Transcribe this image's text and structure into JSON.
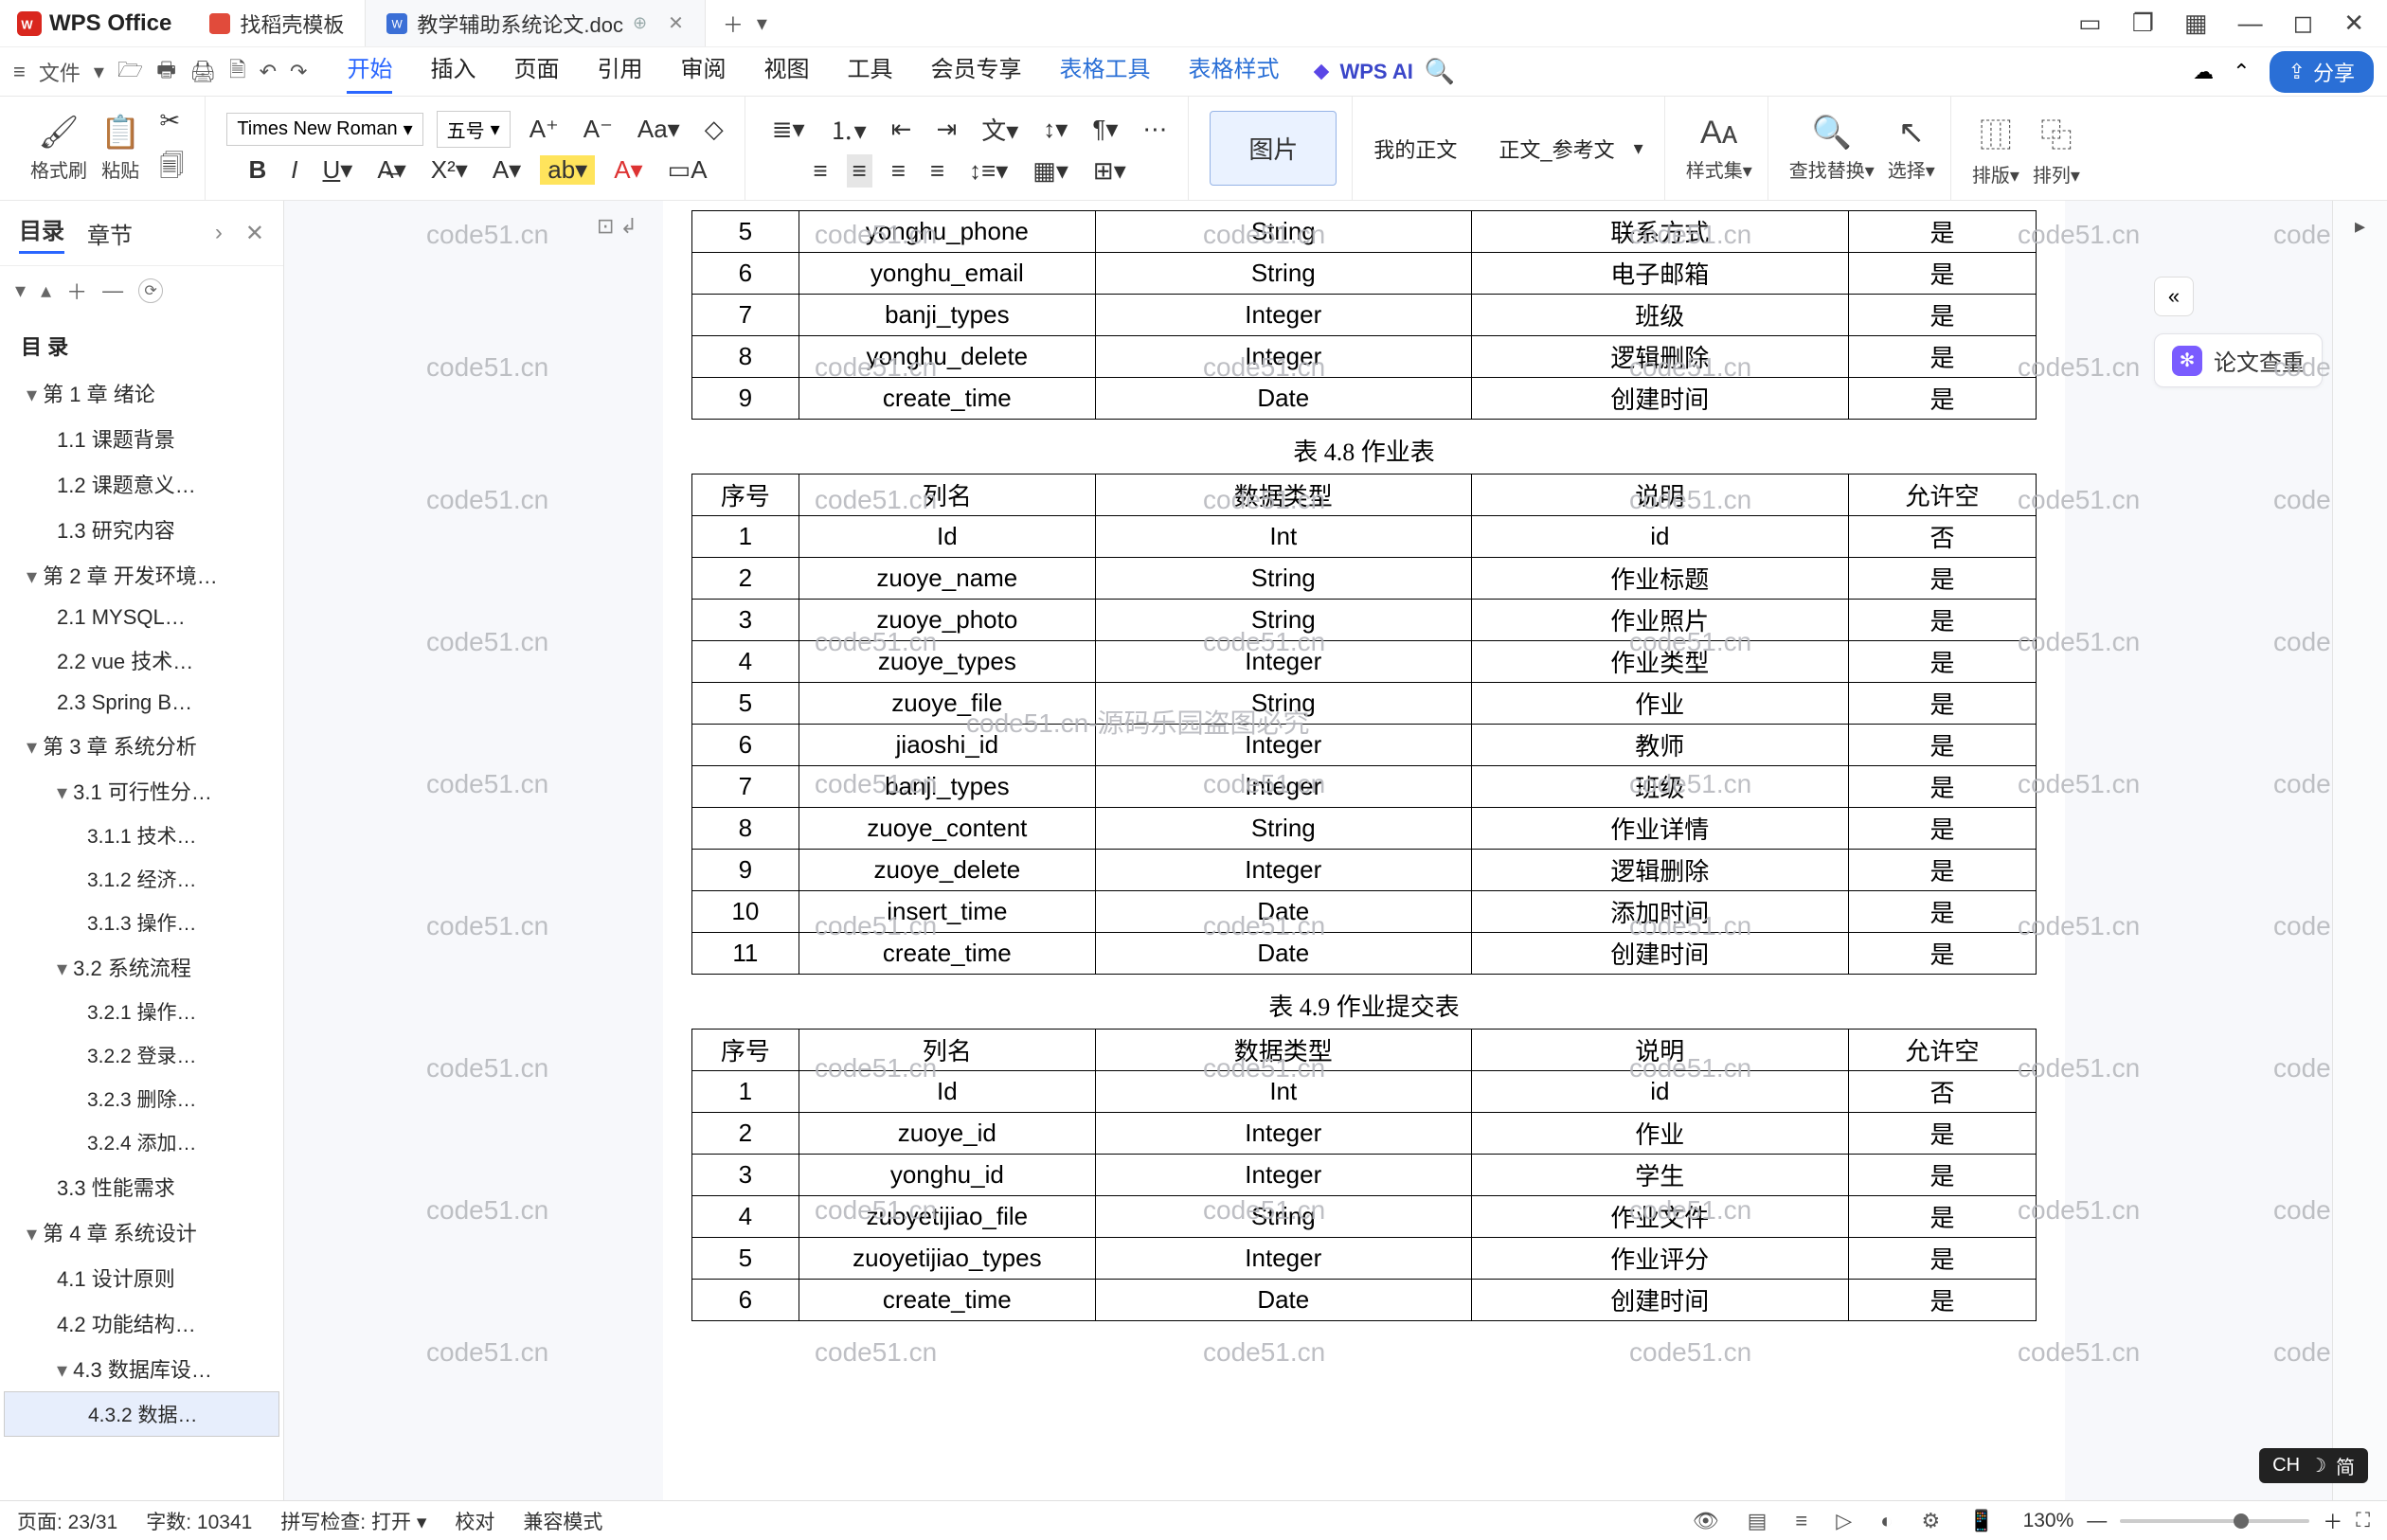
{
  "titlebar": {
    "app": "WPS Office",
    "tabs": [
      {
        "icon": "doc-red",
        "label": "找稻壳模板"
      },
      {
        "icon": "doc-blue",
        "label": "教学辅助系统论文.doc",
        "active": true
      }
    ]
  },
  "menubar": {
    "file": "文件",
    "items": [
      "开始",
      "插入",
      "页面",
      "引用",
      "审阅",
      "视图",
      "工具",
      "会员专享",
      "表格工具",
      "表格样式"
    ],
    "active": 0,
    "blue": [
      8,
      9
    ],
    "wpsai": "WPS AI",
    "share": "分享"
  },
  "ribbon": {
    "format_painter": "格式刷",
    "paste": "粘贴",
    "font_family": "Times New Roman",
    "font_size": "五号",
    "image_btn": "图片",
    "my_body": "我的正文",
    "style_ref": "正文_参考文",
    "styles": "样式集",
    "find": "查找替换",
    "select": "选择",
    "arrange": "排版",
    "align": "排列"
  },
  "sidebar": {
    "tab1": "目录",
    "tab2": "章节",
    "title": "目 录",
    "items": [
      {
        "lvl": 1,
        "txt": "第 1 章 绪论"
      },
      {
        "lvl": 2,
        "txt": "1.1 课题背景"
      },
      {
        "lvl": 2,
        "txt": "1.2 课题意义…"
      },
      {
        "lvl": 2,
        "txt": "1.3 研究内容"
      },
      {
        "lvl": 1,
        "txt": "第 2 章 开发环境…"
      },
      {
        "lvl": 2,
        "txt": "2.1 MYSQL…"
      },
      {
        "lvl": 2,
        "txt": "2.2 vue 技术…"
      },
      {
        "lvl": 2,
        "txt": "2.3 Spring B…"
      },
      {
        "lvl": 1,
        "txt": "第 3 章 系统分析"
      },
      {
        "lvl": 2,
        "txt": "3.1 可行性分…",
        "exp": true
      },
      {
        "lvl": 3,
        "txt": "3.1.1 技术…"
      },
      {
        "lvl": 3,
        "txt": "3.1.2 经济…"
      },
      {
        "lvl": 3,
        "txt": "3.1.3 操作…"
      },
      {
        "lvl": 2,
        "txt": "3.2 系统流程",
        "exp": true
      },
      {
        "lvl": 3,
        "txt": "3.2.1 操作…"
      },
      {
        "lvl": 3,
        "txt": "3.2.2 登录…"
      },
      {
        "lvl": 3,
        "txt": "3.2.3 删除…"
      },
      {
        "lvl": 3,
        "txt": "3.2.4 添加…"
      },
      {
        "lvl": 2,
        "txt": "3.3 性能需求"
      },
      {
        "lvl": 1,
        "txt": "第 4 章 系统设计"
      },
      {
        "lvl": 2,
        "txt": "4.1 设计原则"
      },
      {
        "lvl": 2,
        "txt": "4.2 功能结构…"
      },
      {
        "lvl": 2,
        "txt": "4.3 数据库设…",
        "exp": true
      },
      {
        "lvl": 3,
        "txt": "4.3.2 数据…",
        "sel": true
      }
    ]
  },
  "doc": {
    "frag_rows": [
      [
        "5",
        "yonghu_phone",
        "String",
        "联系方式",
        "是"
      ],
      [
        "6",
        "yonghu_email",
        "String",
        "电子邮箱",
        "是"
      ],
      [
        "7",
        "banji_types",
        "Integer",
        "班级",
        "是"
      ],
      [
        "8",
        "yonghu_delete",
        "Integer",
        "逻辑删除",
        "是"
      ],
      [
        "9",
        "create_time",
        "Date",
        "创建时间",
        "是"
      ]
    ],
    "t48_cap": "表 4.8 作业表",
    "t_head": [
      "序号",
      "列名",
      "数据类型",
      "说明",
      "允许空"
    ],
    "t48": [
      [
        "1",
        "Id",
        "Int",
        "id",
        "否"
      ],
      [
        "2",
        "zuoye_name",
        "String",
        "作业标题",
        "是"
      ],
      [
        "3",
        "zuoye_photo",
        "String",
        "作业照片",
        "是"
      ],
      [
        "4",
        "zuoye_types",
        "Integer",
        "作业类型",
        "是"
      ],
      [
        "5",
        "zuoye_file",
        "String",
        "作业",
        "是"
      ],
      [
        "6",
        "jiaoshi_id",
        "Integer",
        "教师",
        "是"
      ],
      [
        "7",
        "banji_types",
        "Integer",
        "班级",
        "是"
      ],
      [
        "8",
        "zuoye_content",
        "String",
        "作业详情",
        "是"
      ],
      [
        "9",
        "zuoye_delete",
        "Integer",
        "逻辑删除",
        "是"
      ],
      [
        "10",
        "insert_time",
        "Date",
        "添加时间",
        "是"
      ],
      [
        "11",
        "create_time",
        "Date",
        "创建时间",
        "是"
      ]
    ],
    "t49_cap": "表 4.9 作业提交表",
    "t49": [
      [
        "1",
        "Id",
        "Int",
        "id",
        "否"
      ],
      [
        "2",
        "zuoye_id",
        "Integer",
        "作业",
        "是"
      ],
      [
        "3",
        "yonghu_id",
        "Integer",
        "学生",
        "是"
      ],
      [
        "4",
        "zuoyetijiao_file",
        "String",
        "作业文件",
        "是"
      ],
      [
        "5",
        "zuoyetijiao_types",
        "Integer",
        "作业评分",
        "是"
      ],
      [
        "6",
        "create_time",
        "Date",
        "创建时间",
        "是"
      ]
    ],
    "wm_main": "code51.cn-源码乐园盗图必究",
    "wm": "code51.cn"
  },
  "right": {
    "check": "论文查重"
  },
  "status": {
    "page": "页面: 23/31",
    "words": "字数: 10341",
    "spell": "拼写检查: 打开",
    "proof": "校对",
    "compat": "兼容模式",
    "zoom": "130%"
  },
  "ime": {
    "lang": "CH",
    "mode": "简"
  }
}
